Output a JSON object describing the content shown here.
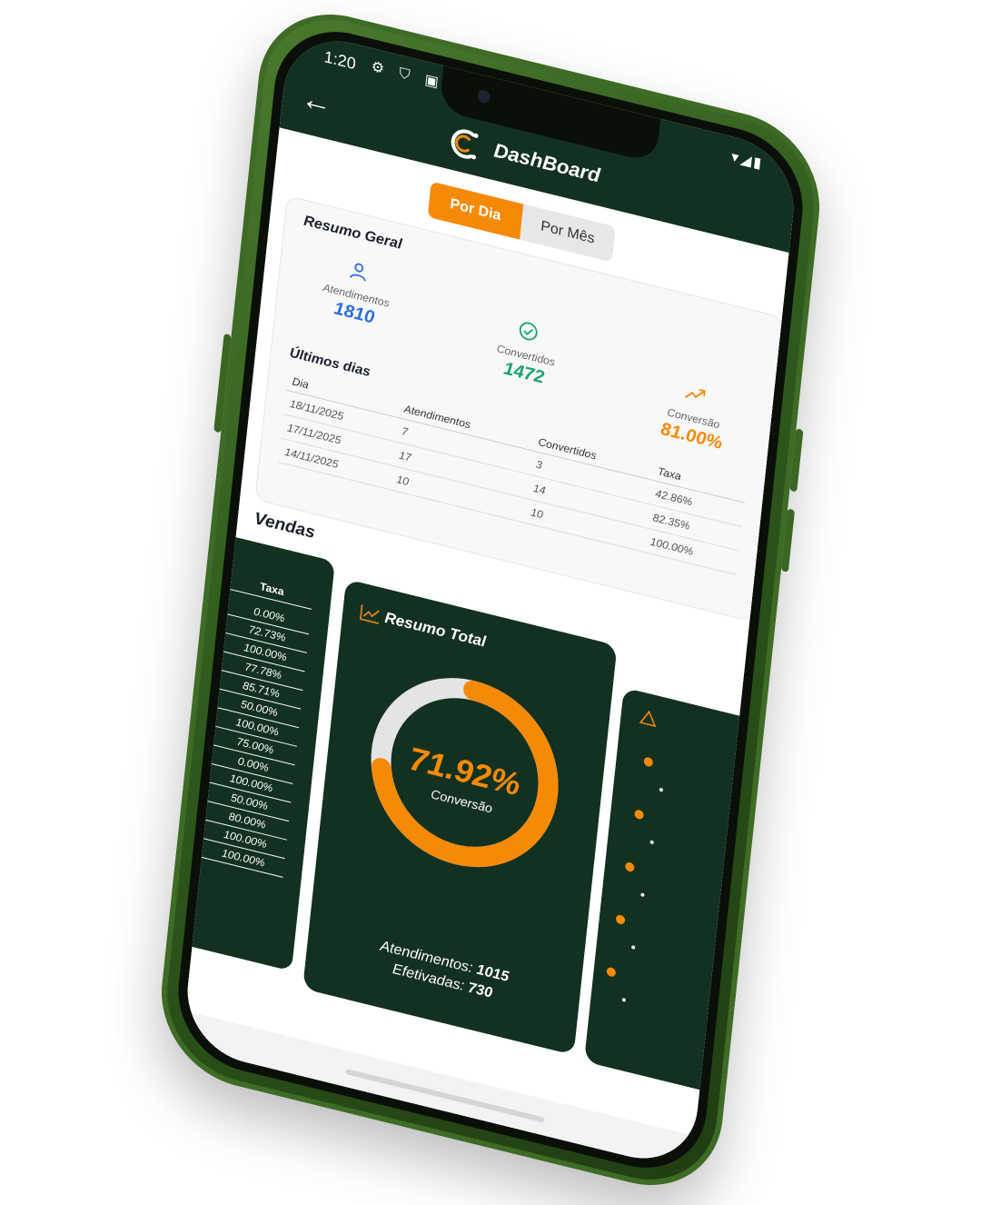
{
  "status": {
    "time": "1:20",
    "icons_left": "⚙ ⛉ ▣",
    "icons_right": "▾◢▮"
  },
  "header": {
    "title": "DashBoard",
    "back_icon": "←"
  },
  "tabs": [
    {
      "label": "Por Dia",
      "active": true
    },
    {
      "label": "Por Mês",
      "active": false
    }
  ],
  "summary": {
    "title": "Resumo Geral",
    "kpis": [
      {
        "label": "Atendimentos",
        "value": "1810",
        "icon": "user-icon",
        "color": "#2f6fe0"
      },
      {
        "label": "Convertidos",
        "value": "1472",
        "icon": "check-circle-icon",
        "color": "#1aa56b"
      },
      {
        "label": "Conversão",
        "value": "81.00%",
        "icon": "trending-up-icon",
        "color": "#f58a07"
      }
    ],
    "last_days": {
      "title": "Últimos dias",
      "columns": [
        "Dia",
        "Atendimentos",
        "Convertidos",
        "Taxa"
      ],
      "rows": [
        [
          "18/11/2025",
          "7",
          "3",
          "42.86%"
        ],
        [
          "17/11/2025",
          "17",
          "14",
          "82.35%"
        ],
        [
          "14/11/2025",
          "10",
          "10",
          "100.00%"
        ]
      ]
    }
  },
  "sales": {
    "title": "Vendas",
    "taxa_header": "Taxa",
    "taxa_values": [
      "0.00%",
      "72.73%",
      "100.00%",
      "77.78%",
      "85.71%",
      "50.00%",
      "100.00%",
      "75.00%",
      "0.00%",
      "100.00%",
      "50.00%",
      "80.00%",
      "100.00%",
      "100.00%"
    ],
    "total": {
      "title": "Resumo Total",
      "icon": "line-chart-icon",
      "conversion_value": "71.92%",
      "conversion_fraction": 0.7192,
      "conversion_label": "Conversão",
      "atendimentos_label": "Atendimentos:",
      "atendimentos_value": "1015",
      "efetivadas_label": "Efetivadas:",
      "efetivadas_value": "730"
    }
  },
  "colors": {
    "brand_dark": "#123121",
    "accent": "#f58a07",
    "phone_green": "#3e6b25"
  }
}
